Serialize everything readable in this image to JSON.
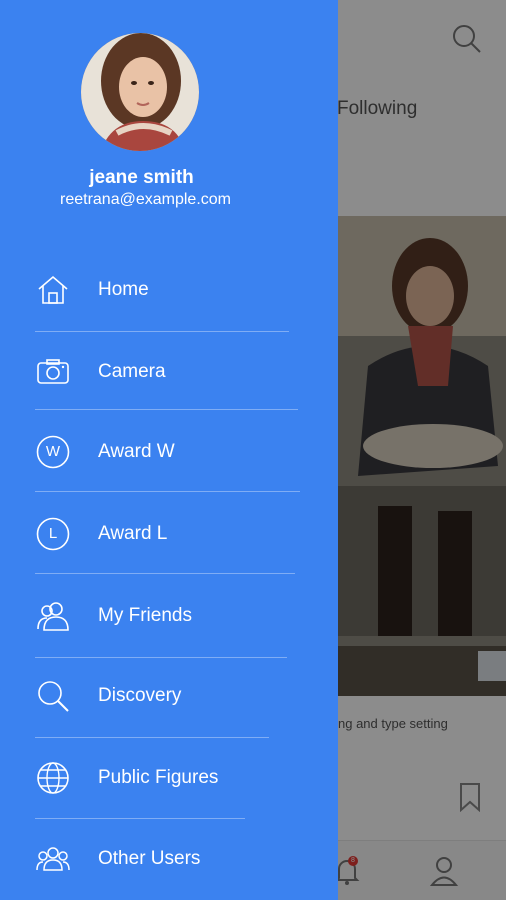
{
  "user": {
    "name": "jeane smith",
    "email": "reetrana@example.com"
  },
  "menu": [
    {
      "label": "Home",
      "icon": "home-icon"
    },
    {
      "label": "Camera",
      "icon": "camera-icon"
    },
    {
      "label": "Award W",
      "icon": "award-w-icon",
      "glyph": "W"
    },
    {
      "label": "Award L",
      "icon": "award-l-icon",
      "glyph": "L"
    },
    {
      "label": "My Friends",
      "icon": "friends-icon"
    },
    {
      "label": "Discovery",
      "icon": "search-icon"
    },
    {
      "label": "Public Figures",
      "icon": "globe-icon"
    },
    {
      "label": "Other Users",
      "icon": "users-icon"
    }
  ],
  "background": {
    "tab_label": "Following",
    "caption": "ng and type setting",
    "notification_count": "8"
  },
  "colors": {
    "drawer": "#3b82f0",
    "text": "#ffffff"
  }
}
